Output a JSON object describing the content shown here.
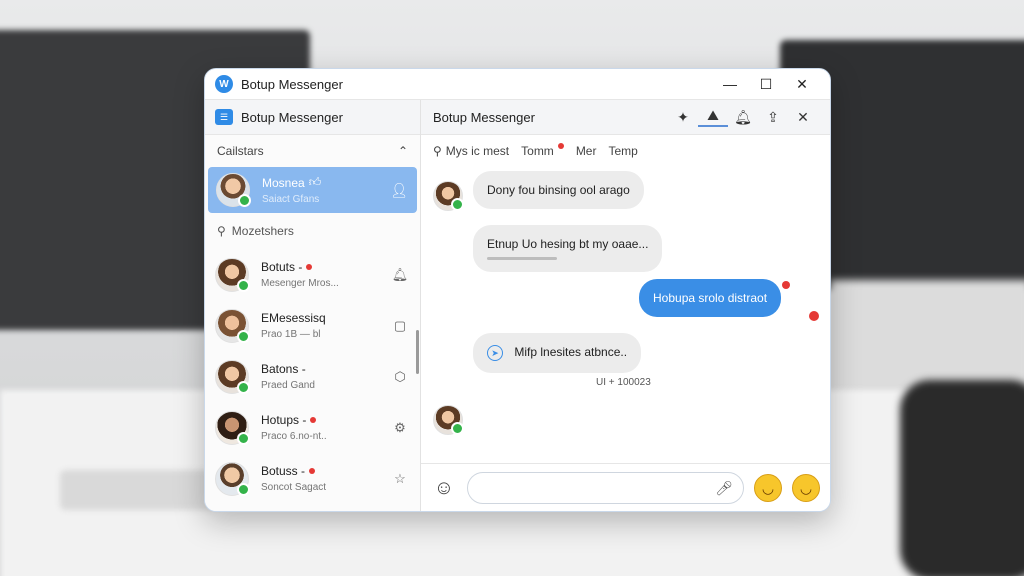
{
  "window": {
    "title": "Botup Messenger",
    "controls": {
      "minimize": "—",
      "maximize": "☐",
      "close": "✕"
    }
  },
  "sidebar": {
    "title": "Botup Messenger",
    "section_label": "Cailstars",
    "search_label": "Mozetshers",
    "active_contact": {
      "name": "Mosnea",
      "sub": "Saiact Gfans",
      "icon": "person-icon"
    },
    "contacts": [
      {
        "name": "Botuts -",
        "sub": "Mesenger Mros...",
        "icon": "bell-icon",
        "unread": true
      },
      {
        "name": "EMesessisq",
        "sub": "Prao 1B — bl",
        "icon": "chat-icon",
        "unread": false
      },
      {
        "name": "Batons -",
        "sub": "Praed Gand",
        "icon": "hexagon-icon",
        "unread": false
      },
      {
        "name": "Hotups -",
        "sub": "Praco 6.no-nt..",
        "icon": "gear-icon",
        "unread": true
      },
      {
        "name": "Botuss -",
        "sub": "Soncot Sagact",
        "icon": "star-icon",
        "unread": true
      }
    ]
  },
  "chat": {
    "title": "Botup Messenger",
    "filters": [
      "Mys ic mest",
      "Tomm",
      "Mer",
      "Temp"
    ],
    "messages": [
      {
        "text": "Dony fou binsing ool arago",
        "dir": "in"
      },
      {
        "text": "Etnup Uo hesing bt my oaae...",
        "dir": "in"
      },
      {
        "text": "Hobupa srolo distraot",
        "dir": "out"
      },
      {
        "text": "Mifp lnesites atbnce..",
        "dir": "in"
      }
    ],
    "timestamp": "UI + 100023",
    "composer": {
      "placeholder": ""
    }
  },
  "colors": {
    "accent": "#3a8ee6",
    "online": "#34b34a",
    "unread": "#e53935",
    "active_row": "#89b8ef"
  }
}
